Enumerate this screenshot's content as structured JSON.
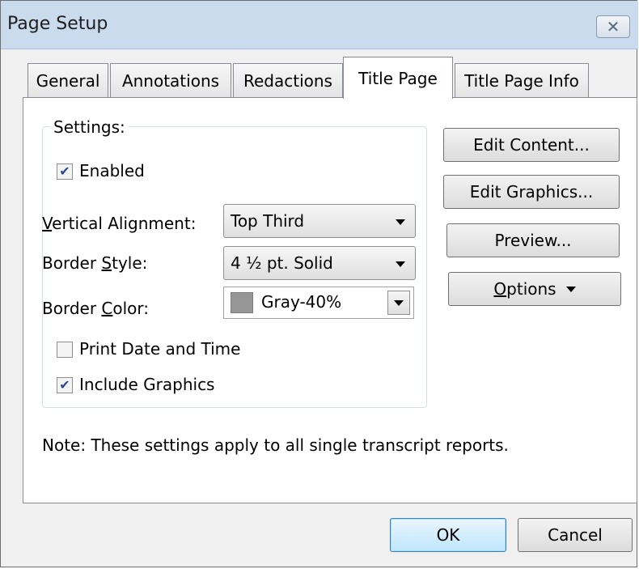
{
  "window": {
    "title": "Page Setup",
    "close_symbol": "✕"
  },
  "tabs": [
    {
      "label": "General",
      "active": false
    },
    {
      "label": "Annotations",
      "active": false
    },
    {
      "label": "Redactions",
      "active": false
    },
    {
      "label": "Title Page",
      "active": true
    },
    {
      "label": "Title Page Info",
      "active": false
    }
  ],
  "settings": {
    "group_label": "Settings:",
    "enabled": {
      "label": "Enabled",
      "checked": true
    },
    "vertical_alignment": {
      "label_pre": "",
      "label_mnemonic": "V",
      "label_post": "ertical Alignment:",
      "value": "Top Third"
    },
    "border_style": {
      "label_pre": "Border ",
      "label_mnemonic": "S",
      "label_post": "tyle:",
      "value": "4 ½ pt. Solid"
    },
    "border_color": {
      "label_pre": "Border ",
      "label_mnemonic": "C",
      "label_post": "olor:",
      "value": "Gray-40%",
      "swatch_color": "#969696"
    },
    "print_date_time": {
      "label": "Print Date and Time",
      "checked": false
    },
    "include_graphics": {
      "label": "Include Graphics",
      "checked": true
    }
  },
  "side_buttons": {
    "edit_content": "Edit Content...",
    "edit_graphics": "Edit Graphics...",
    "preview": "Preview...",
    "options_mnemonic": "O",
    "options_rest": "ptions"
  },
  "note": "Note: These settings apply to all single transcript reports.",
  "footer": {
    "ok": "OK",
    "cancel": "Cancel"
  },
  "check_mark": "✔",
  "colors": {
    "titlebar": "#c9dbed",
    "default_button": "#bee6fd",
    "panel": "#ffffff"
  }
}
